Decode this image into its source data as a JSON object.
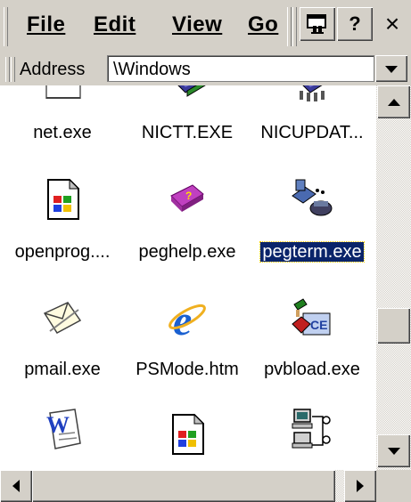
{
  "menu": {
    "file": "File",
    "edit": "Edit",
    "view": "View",
    "go": "Go"
  },
  "toolbar": {
    "properties_icon": "properties-icon",
    "help_label": "?",
    "close_label": "×"
  },
  "address": {
    "label": "Address",
    "value": "\\Windows"
  },
  "files": [
    {
      "name": "net.exe",
      "icon": "blank-window-icon",
      "selected": false
    },
    {
      "name": "NICTT.EXE",
      "icon": "network-card-icon",
      "selected": false
    },
    {
      "name": "NICUPDAT...",
      "icon": "network-card-update-icon",
      "selected": false
    },
    {
      "name": "openprog....",
      "icon": "windows-program-icon",
      "selected": false
    },
    {
      "name": "peghelp.exe",
      "icon": "help-book-icon",
      "selected": false
    },
    {
      "name": "pegterm.exe",
      "icon": "terminal-phone-icon",
      "selected": true
    },
    {
      "name": "pmail.exe",
      "icon": "envelope-icon",
      "selected": false
    },
    {
      "name": "PSMode.htm",
      "icon": "internet-explorer-icon",
      "selected": false
    },
    {
      "name": "pvbload.exe",
      "icon": "ce-setup-icon",
      "selected": false
    },
    {
      "name": "",
      "icon": "word-doc-icon",
      "selected": false
    },
    {
      "name": "",
      "icon": "windows-program-icon",
      "selected": false
    },
    {
      "name": "",
      "icon": "network-computers-icon",
      "selected": false
    }
  ],
  "colors": {
    "chrome": "#d4d0c8",
    "selection": "#0a246a",
    "selection_text": "#ffffff"
  }
}
